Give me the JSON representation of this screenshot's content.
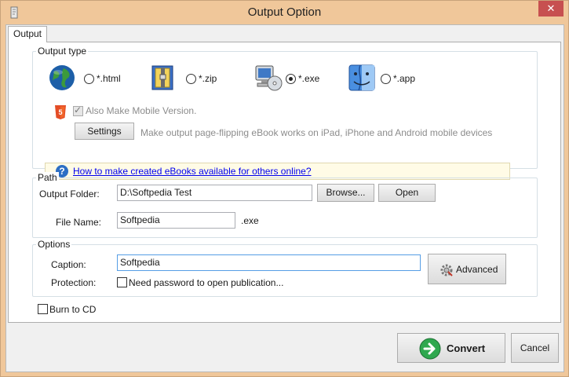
{
  "window": {
    "title": "Output Option",
    "close_glyph": "✕",
    "app_icon": "flipbook-app-icon"
  },
  "tabs": [
    {
      "label": "Output"
    }
  ],
  "output_type": {
    "label": "Output type",
    "options": [
      {
        "label": "*.html",
        "icon": "globe-icon",
        "selected": false
      },
      {
        "label": "*.zip",
        "icon": "zip-archive-icon",
        "selected": false
      },
      {
        "label": "*.exe",
        "icon": "computer-cd-icon",
        "selected": true
      },
      {
        "label": "*.app",
        "icon": "mac-finder-icon",
        "selected": false
      }
    ],
    "mobile_label": "Also Make Mobile Version.",
    "mobile_checked": true,
    "settings_label": "Settings",
    "mobile_hint": "Make output page-flipping eBook works on iPad, iPhone and Android mobile devices",
    "help_link": "How to make created eBooks available for others online?"
  },
  "path": {
    "label": "Path",
    "folder_label": "Output Folder:",
    "folder_value": "D:\\Softpedia Test",
    "browse_label": "Browse...",
    "open_label": "Open",
    "filename_label": "File Name:",
    "filename_value": "Softpedia",
    "extension": ".exe"
  },
  "options": {
    "label": "Options",
    "caption_label": "Caption:",
    "caption_value": "Softpedia",
    "protection_label": "Protection:",
    "password_label": "Need password to open publication...",
    "password_checked": false,
    "advanced_label": "Advanced"
  },
  "burn": {
    "label": "Burn to CD",
    "checked": false
  },
  "footer": {
    "convert_label": "Convert",
    "cancel_label": "Cancel"
  }
}
